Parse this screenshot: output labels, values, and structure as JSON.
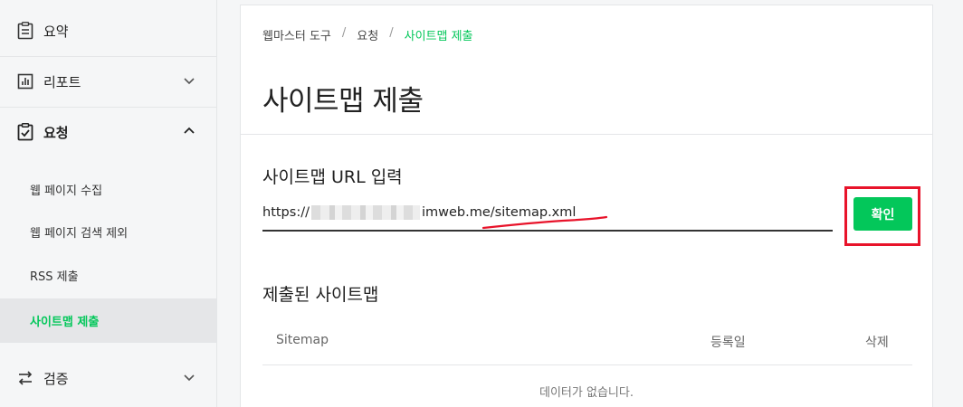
{
  "sidebar": {
    "items": [
      {
        "label": "요약",
        "icon": "clipboard-icon"
      },
      {
        "label": "리포트",
        "icon": "bar-chart-icon"
      },
      {
        "label": "요청",
        "icon": "clipboard-check-icon"
      },
      {
        "label": "검증",
        "icon": "swap-arrows-icon"
      }
    ],
    "sub_items": [
      {
        "label": "웹 페이지 수집"
      },
      {
        "label": "웹 페이지 검색 제외"
      },
      {
        "label": "RSS 제출"
      },
      {
        "label": "사이트맵 제출"
      }
    ]
  },
  "breadcrumb": {
    "items": [
      "웹마스터 도구",
      "요청",
      "사이트맵 제출"
    ],
    "separator": "/"
  },
  "page": {
    "title": "사이트맵 제출"
  },
  "sitemap_form": {
    "label": "사이트맵 URL 입력",
    "value_prefix": "https://",
    "value_suffix": "imweb.me/sitemap.xml",
    "submit_label": "확인"
  },
  "submitted": {
    "title": "제출된 사이트맵",
    "columns": [
      "Sitemap",
      "등록일",
      "삭제"
    ],
    "empty_message": "데이터가 없습니다."
  },
  "colors": {
    "accent": "#03c75a",
    "highlight_box": "#e8132a",
    "annotation_underline": "#e8132a"
  }
}
